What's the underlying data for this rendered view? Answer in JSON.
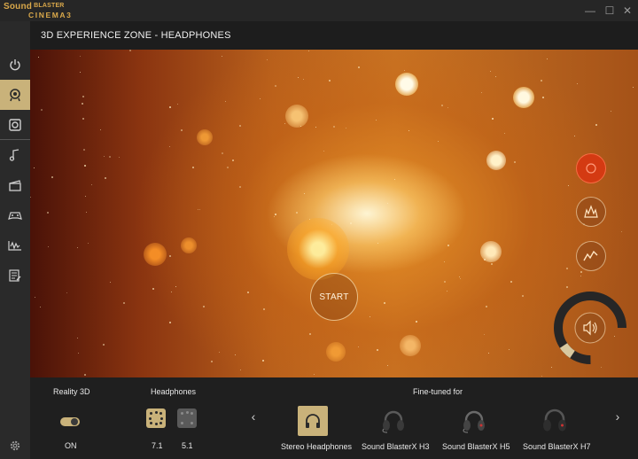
{
  "app": {
    "logo_line1": "Sound",
    "logo_line1_small": "BLASTER",
    "logo_line2": "CINEMA3",
    "window_controls": {
      "minimize": "—",
      "maximize": "☐",
      "close": "✕"
    }
  },
  "sidebar": {
    "items": [
      {
        "name": "power-icon",
        "active": false
      },
      {
        "name": "headphones-3d-icon",
        "active": true
      },
      {
        "name": "speaker-icon",
        "active": false
      },
      {
        "name": "music-note-icon",
        "active": false
      },
      {
        "name": "movie-clapper-icon",
        "active": false
      },
      {
        "name": "game-controller-icon",
        "active": false
      },
      {
        "name": "voice-waveform-icon",
        "active": false
      },
      {
        "name": "notes-icon",
        "active": false
      }
    ],
    "settings_icon": "gear-icon"
  },
  "header": {
    "title": "3D EXPERIENCE ZONE - HEADPHONES"
  },
  "visual": {
    "start_label": "START",
    "effects": [
      {
        "name": "record-icon",
        "on": true
      },
      {
        "name": "explosion-icon",
        "on": false
      },
      {
        "name": "bass-wave-icon",
        "on": false
      }
    ],
    "volume_icon": "speaker-volume-icon",
    "volume_level": 0.86
  },
  "bottom": {
    "reality3d": {
      "label": "Reality 3D",
      "state": "ON"
    },
    "headphones": {
      "label": "Headphones",
      "options": [
        "7.1",
        "5.1"
      ],
      "selected": "7.1"
    },
    "finetuned": {
      "label": "Fine-tuned for",
      "devices": [
        {
          "label": "Stereo Headphones",
          "selected": true
        },
        {
          "label": "Sound BlasterX H3",
          "selected": false
        },
        {
          "label": "Sound BlasterX H5",
          "selected": false
        },
        {
          "label": "Sound BlasterX H7",
          "selected": false
        }
      ],
      "prev": "‹",
      "next": "›"
    }
  },
  "colors": {
    "accent": "#c9b27a",
    "effect_on": "#d43a12",
    "background": "#1f1f1f"
  }
}
